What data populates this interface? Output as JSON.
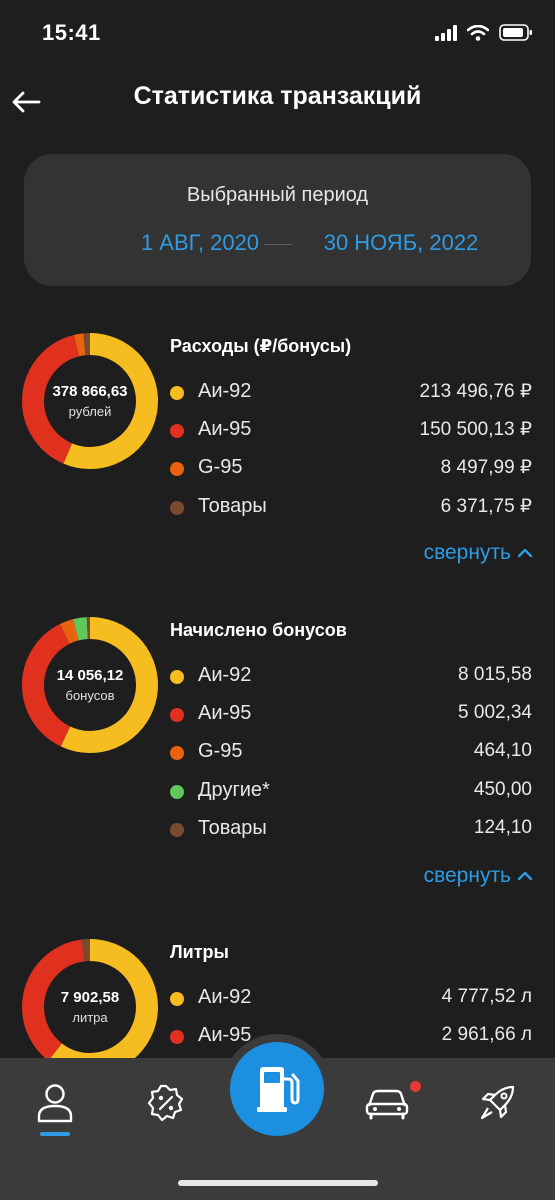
{
  "status": {
    "time": "15:41"
  },
  "header": {
    "title": "Статистика транзакций",
    "back_icon": "arrow-left-icon"
  },
  "period": {
    "label": "Выбранный период",
    "from": "1 АВГ, 2020",
    "to": "30 НОЯБ, 2022"
  },
  "colors": {
    "ai92": "#f5bd1f",
    "ai95": "#e0301e",
    "g95": "#e8620f",
    "goods": "#7a4a2e",
    "other": "#5ec95a",
    "accent": "#2e9be4"
  },
  "sections": [
    {
      "title": "Расходы (₽/бонусы)",
      "center_value": "378 866,63",
      "center_unit": "рублей",
      "items": [
        {
          "name": "Аи-92",
          "value": "213 496,76 ₽",
          "color": "#f5bd1f"
        },
        {
          "name": "Аи-95",
          "value": "150 500,13 ₽",
          "color": "#e0301e"
        },
        {
          "name": "G-95",
          "value": "8 497,99 ₽",
          "color": "#e8620f"
        },
        {
          "name": "Товары",
          "value": "6 371,75 ₽",
          "color": "#7a4a2e"
        }
      ],
      "shares": [
        213496.76,
        150500.13,
        8497.99,
        6371.75
      ],
      "collapse_label": "свернуть"
    },
    {
      "title": "Начислено бонусов",
      "center_value": "14 056,12",
      "center_unit": "бонусов",
      "items": [
        {
          "name": "Аи-92",
          "value": "8 015,58",
          "color": "#f5bd1f"
        },
        {
          "name": "Аи-95",
          "value": "5 002,34",
          "color": "#e0301e"
        },
        {
          "name": "G-95",
          "value": "464,10",
          "color": "#e8620f"
        },
        {
          "name": "Другие*",
          "value": "450,00",
          "color": "#5ec95a"
        },
        {
          "name": "Товары",
          "value": "124,10",
          "color": "#7a4a2e"
        }
      ],
      "shares": [
        8015.58,
        5002.34,
        464.1,
        450.0,
        124.1
      ],
      "collapse_label": "свернуть"
    },
    {
      "title": "Литры",
      "center_value": "7 902,58",
      "center_unit": "литра",
      "items": [
        {
          "name": "Аи-92",
          "value": "4 777,52 л",
          "color": "#f5bd1f"
        },
        {
          "name": "Аи-95",
          "value": "2 961,66 л",
          "color": "#e0301e"
        }
      ],
      "shares": [
        4777.52,
        2961.66,
        163.4
      ]
    }
  ],
  "tabs": [
    {
      "name": "profile",
      "icon": "user-icon"
    },
    {
      "name": "promotions",
      "icon": "discount-badge-icon"
    },
    {
      "name": "fuel",
      "icon": "fuel-pump-icon"
    },
    {
      "name": "cars",
      "icon": "car-icon"
    },
    {
      "name": "more",
      "icon": "rocket-icon"
    }
  ]
}
